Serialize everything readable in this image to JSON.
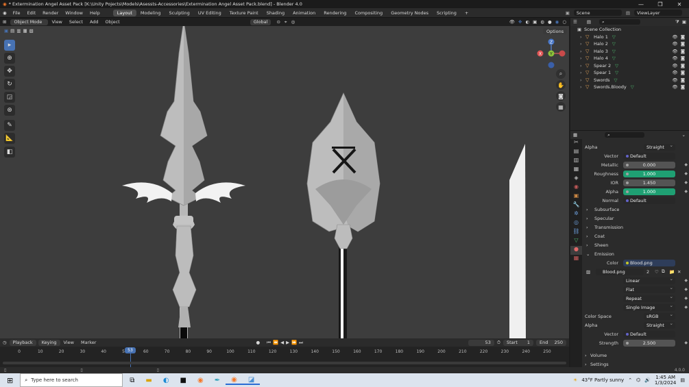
{
  "titlebar": {
    "title": "* Extermination Angel Asset Pack [K:\\Unity Pojects\\Models\\Asessts-Accessories\\Extermination Angel Asset Pack.blend] - Blender 4.0",
    "min": "—",
    "max": "❐",
    "close": "✕"
  },
  "menu": {
    "items": [
      "File",
      "Edit",
      "Render",
      "Window",
      "Help"
    ]
  },
  "workspaces": {
    "tabs": [
      "Layout",
      "Modeling",
      "Sculpting",
      "UV Editing",
      "Texture Paint",
      "Shading",
      "Animation",
      "Rendering",
      "Compositing",
      "Geometry Nodes",
      "Scripting"
    ],
    "active": "Layout",
    "add": "+"
  },
  "scene": {
    "name": "Scene",
    "view_layer": "ViewLayer"
  },
  "viewport_header": {
    "mode": "Object Mode",
    "menus": [
      "View",
      "Select",
      "Add",
      "Object"
    ],
    "orientation": "Global",
    "options": "Options"
  },
  "gizmo": {
    "x": "X",
    "y": "Y",
    "z": "Z"
  },
  "outliner": {
    "search_placeholder": "",
    "collection": "Scene Collection",
    "items": [
      "Halo 1",
      "Halo 2",
      "Halo 3",
      "Halo 4",
      "Spear 2",
      "Spear 1",
      "Swords",
      "Swords.Bloody"
    ]
  },
  "properties": {
    "alpha_mode_label": "Alpha",
    "alpha_mode": "Straight",
    "vector_label": "Vector",
    "vector": "Default",
    "metallic_label": "Metallic",
    "metallic": "0.000",
    "roughness_label": "Roughness",
    "roughness": "1.000",
    "roughness_fill": 1.0,
    "ior_label": "IOR",
    "ior": "1.450",
    "alpha_label": "Alpha",
    "alpha": "1.000",
    "alpha_fill": 1.0,
    "normal_label": "Normal",
    "normal": "Default",
    "sections": [
      "Subsurface",
      "Specular",
      "Transmission",
      "Coat",
      "Sheen",
      "Emission"
    ],
    "color_label": "Color",
    "color": "Blood.png",
    "image_name": "Blood.png",
    "image_users": "2",
    "interpolation": "Linear",
    "projection": "Flat",
    "extension": "Repeat",
    "source": "Single Image",
    "colorspace_label": "Color Space",
    "colorspace": "sRGB",
    "alpha2_label": "Alpha",
    "alpha2": "Straight",
    "vector2_label": "Vector",
    "vector2": "Default",
    "strength_label": "Strength",
    "strength": "2.500",
    "volume": "Volume",
    "settings": "Settings"
  },
  "timeline": {
    "menus": [
      "Playback",
      "Keying",
      "View",
      "Marker"
    ],
    "current": "53",
    "start_label": "Start",
    "start": "1",
    "end_label": "End",
    "end": "250",
    "ticks": [
      "0",
      "10",
      "20",
      "30",
      "40",
      "50",
      "60",
      "70",
      "80",
      "90",
      "100",
      "110",
      "120",
      "130",
      "140",
      "150",
      "160",
      "170",
      "180",
      "190",
      "200",
      "210",
      "220",
      "230",
      "240",
      "250"
    ],
    "playhead": "53"
  },
  "status": {
    "version": "4.0.0"
  },
  "taskbar": {
    "search_placeholder": "Type here to search",
    "weather": "43°F  Partly sunny",
    "time": "1:45 AM",
    "date": "1/3/2024"
  },
  "colors": {
    "accent": "#4772b3",
    "socket_yellow": "#c7c729",
    "socket_blue": "#6363c7",
    "socket_gray": "#a1a1a1",
    "bar_green": "#1fa073"
  }
}
